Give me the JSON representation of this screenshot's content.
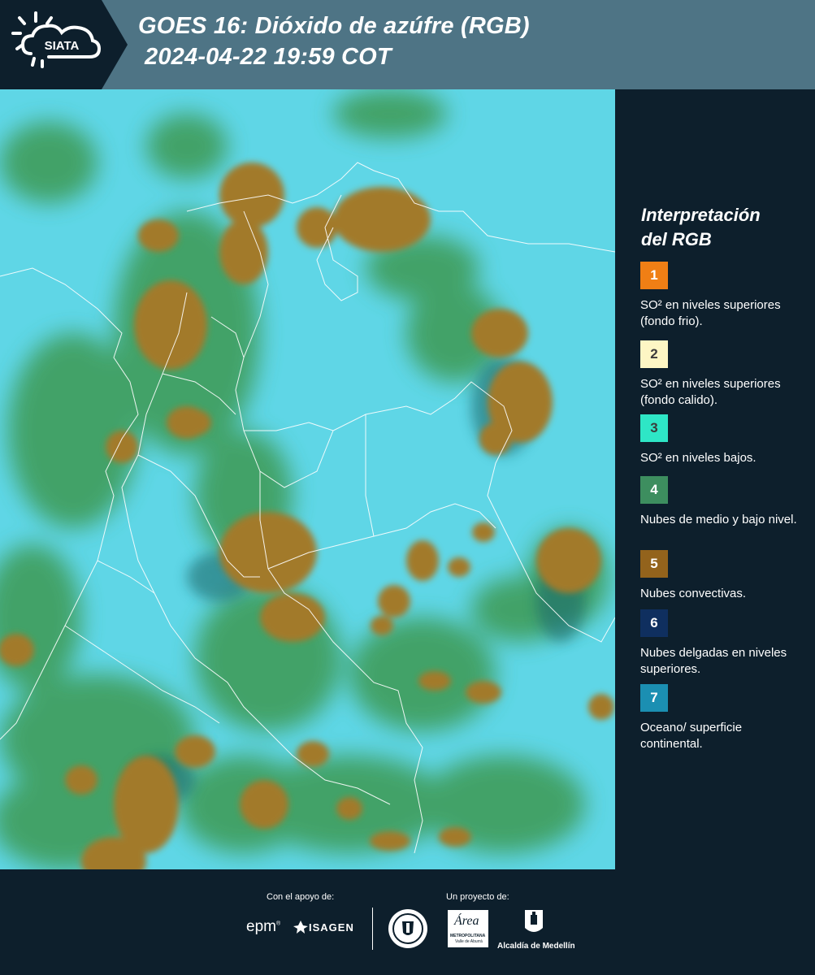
{
  "header": {
    "logo_text": "SIATA",
    "title_line1": "GOES 16: Dióxido de azúfre (RGB)",
    "title_line2": "2024-04-22 19:59 COT"
  },
  "legend": {
    "title_line1": "Interpretación",
    "title_line2": "del RGB",
    "items": [
      {
        "number": "1",
        "color": "#f07f15",
        "text": "SO² en niveles superiores (fondo frio)."
      },
      {
        "number": "2",
        "color": "#fdf6c4",
        "text": "SO² en niveles superiores (fondo calido)."
      },
      {
        "number": "3",
        "color": "#2ee6c6",
        "text": "SO² en niveles bajos."
      },
      {
        "number": "4",
        "color": "#3d8e5f",
        "text": "Nubes de medio y bajo nivel."
      },
      {
        "number": "5",
        "color": "#93631c",
        "text": "Nubes convectivas."
      },
      {
        "number": "6",
        "color": "#0f2f5f",
        "text": "Nubes delgadas en niveles superiores."
      },
      {
        "number": "7",
        "color": "#1b8fb2",
        "text": "Oceano/ superficie continental."
      }
    ]
  },
  "footer": {
    "support_label": "Con el apoyo de:",
    "project_label": "Un proyecto de:",
    "sponsor_epm": "epm",
    "sponsor_isagen": "ISAGEN",
    "area_logo_text": "Área",
    "area_subtext": "METROPOLITANA",
    "area_subtext2": "Valle de Aburrá",
    "alcaldia_text": "Alcaldía de Medellín"
  },
  "colors": {
    "header_bg": "#4e7485",
    "panel_bg": "#0d1f2c",
    "map_surface": "#5fd6e6",
    "map_cloud_low": "#3e9a52",
    "map_convective": "#a27a2c"
  }
}
